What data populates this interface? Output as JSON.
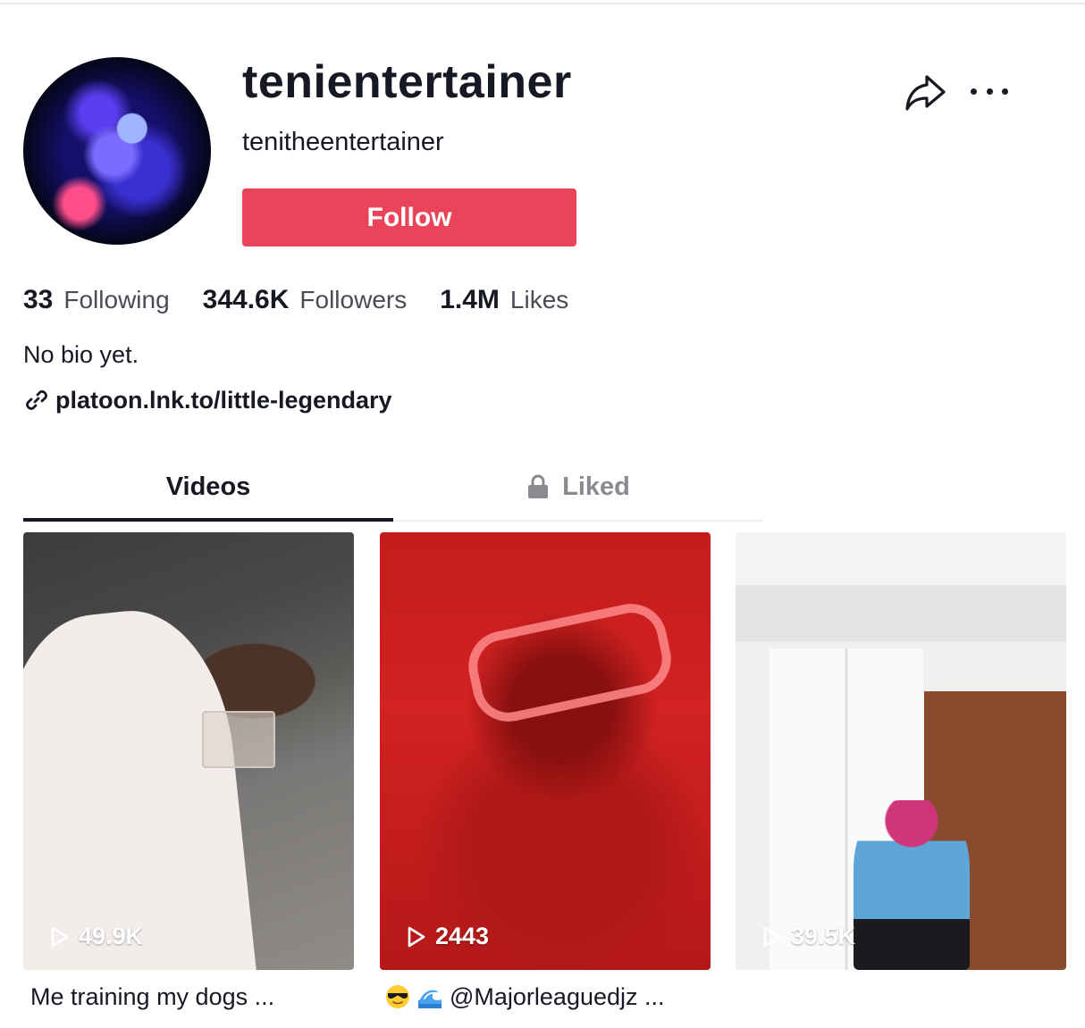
{
  "profile": {
    "display_name": "tenientertainer",
    "username": "tenitheentertainer",
    "follow_label": "Follow",
    "bio": "No bio yet.",
    "link": "platoon.lnk.to/little-legendary"
  },
  "stats": [
    {
      "value": "33",
      "label": "Following"
    },
    {
      "value": "344.6K",
      "label": "Followers"
    },
    {
      "value": "1.4M",
      "label": "Likes"
    }
  ],
  "tabs": {
    "videos": "Videos",
    "liked": "Liked"
  },
  "videos": [
    {
      "views": "49.9K",
      "caption": "Me training my dogs ..."
    },
    {
      "views": "2443",
      "caption": "@Majorleaguedjz ...",
      "caption_emojis": [
        "sunglasses-emoji",
        "wave-emoji"
      ]
    },
    {
      "views": "39.5K",
      "caption": ""
    }
  ],
  "colors": {
    "accent": "#ea445a",
    "text": "#161823",
    "muted": "#8a8b91"
  },
  "icons": {
    "share": "share-arrow-icon",
    "more": "more-dots-icon",
    "link": "link-icon",
    "lock": "lock-icon",
    "play": "play-icon"
  }
}
